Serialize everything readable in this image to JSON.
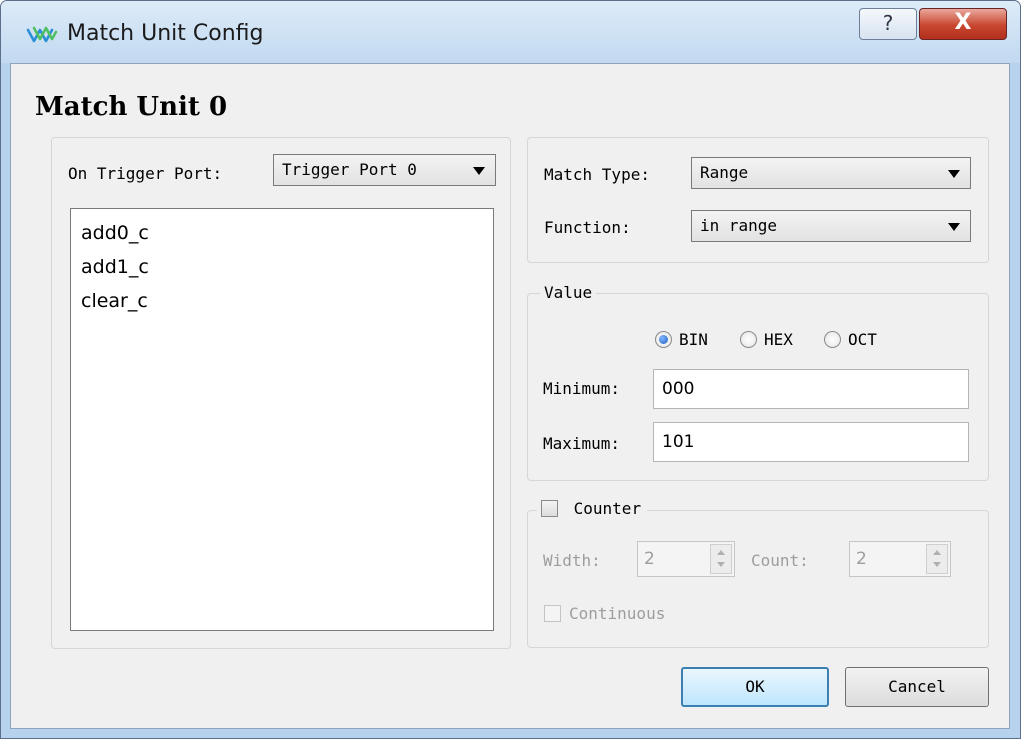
{
  "window": {
    "title": "Match Unit Config",
    "help_label": "?",
    "close_label": "X"
  },
  "heading": "Match Unit 0",
  "trigger": {
    "label": "On Trigger Port:",
    "selected": "Trigger Port 0"
  },
  "signals": [
    "add0_c",
    "add1_c",
    "clear_c"
  ],
  "match": {
    "type_label": "Match Type:",
    "type_value": "Range",
    "function_label": "Function:",
    "function_value": "in range"
  },
  "value": {
    "title": "Value",
    "radix_options": [
      "BIN",
      "HEX",
      "OCT"
    ],
    "selected_radix": "BIN",
    "min_label": "Minimum:",
    "min_value": "000",
    "max_label": "Maximum:",
    "max_value": "101"
  },
  "counter": {
    "label": "Counter",
    "width_label": "Width:",
    "width_value": "2",
    "count_label": "Count:",
    "count_value": "2",
    "continuous_label": "Continuous"
  },
  "buttons": {
    "ok": "OK",
    "cancel": "Cancel"
  },
  "colors": {
    "default_button_border": "#3c7fb1",
    "radio_selected": "#1f5fbf",
    "title_bar": "#c2d9f0"
  },
  "icons": {
    "app": "gowin-logo-icon",
    "help": "help-icon",
    "close": "close-icon"
  }
}
